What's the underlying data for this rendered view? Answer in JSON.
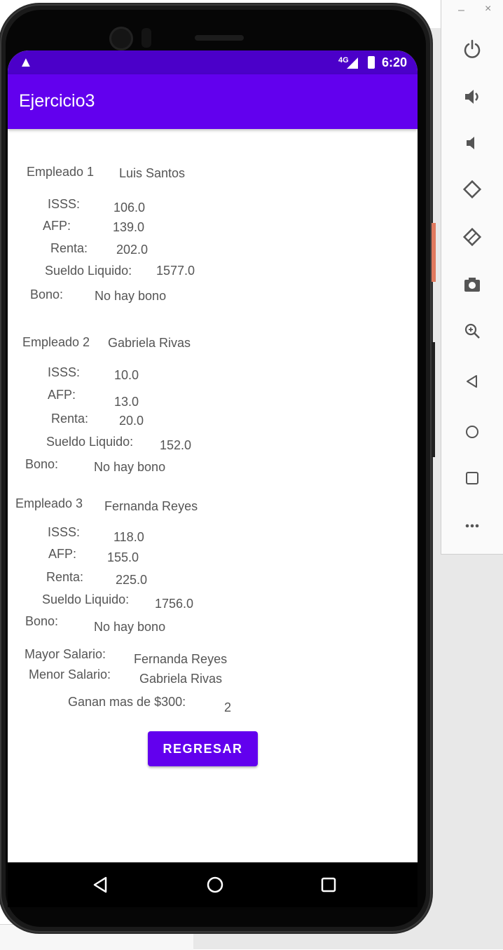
{
  "statusbar": {
    "network": "4G",
    "time": "6:20"
  },
  "app": {
    "title": "Ejercicio3"
  },
  "employees": [
    {
      "label": "Empleado 1",
      "name": "Luis Santos",
      "isss_label": "ISSS:",
      "isss": "106.0",
      "afp_label": "AFP:",
      "afp": "139.0",
      "renta_label": "Renta:",
      "renta": "202.0",
      "sueldo_label": "Sueldo Liquido:",
      "sueldo": "1577.0",
      "bono_label": "Bono:",
      "bono": "No hay bono"
    },
    {
      "label": "Empleado 2",
      "name": "Gabriela Rivas",
      "isss_label": "ISSS:",
      "isss": "10.0",
      "afp_label": "AFP:",
      "afp": "13.0",
      "renta_label": "Renta:",
      "renta": "20.0",
      "sueldo_label": "Sueldo Liquido:",
      "sueldo": "152.0",
      "bono_label": "Bono:",
      "bono": "No hay bono"
    },
    {
      "label": "Empleado 3",
      "name": "Fernanda Reyes",
      "isss_label": "ISSS:",
      "isss": "118.0",
      "afp_label": "AFP:",
      "afp": "155.0",
      "renta_label": "Renta:",
      "renta": "225.0",
      "sueldo_label": "Sueldo Liquido:",
      "sueldo": "1756.0",
      "bono_label": "Bono:",
      "bono": "No hay bono"
    }
  ],
  "summary": {
    "mayor_label": "Mayor Salario:",
    "mayor_value": "Fernanda Reyes",
    "menor_label": "Menor Salario:",
    "menor_value": "Gabriela Rivas",
    "ganan_label": "Ganan mas de $300:",
    "ganan_value": "2"
  },
  "button": {
    "regresar": "REGRESAR"
  },
  "toolbar": {
    "minimize": "–",
    "close": "×"
  },
  "colors": {
    "primary": "#6200ee",
    "status_bar": "#4b00c9",
    "text": "#555555"
  },
  "icons": [
    "warning-icon",
    "signal-icon",
    "battery-icon",
    "power-icon",
    "volume-up-icon",
    "volume-down-icon",
    "rotate-left-icon",
    "rotate-right-icon",
    "camera-icon",
    "zoom-icon",
    "back-icon",
    "home-icon",
    "overview-icon",
    "more-icon"
  ]
}
